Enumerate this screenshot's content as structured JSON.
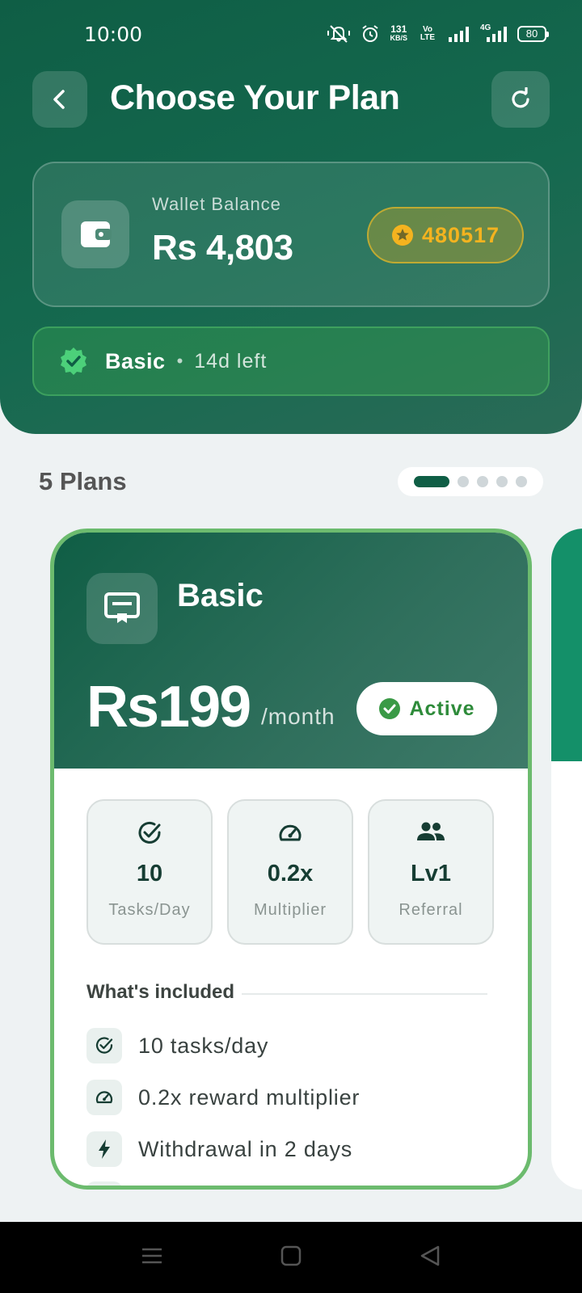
{
  "status_bar": {
    "time": "10:00",
    "net_speed_value": "131",
    "net_speed_unit": "KB/S",
    "volte": "Vo LTE",
    "network": "4G",
    "battery": "80"
  },
  "header": {
    "title": "Choose Your Plan"
  },
  "wallet": {
    "label": "Wallet Balance",
    "amount": "Rs 4,803",
    "coins": "480517"
  },
  "current_plan": {
    "name": "Basic",
    "separator": "•",
    "remaining": "14d left"
  },
  "plans_section": {
    "count_label": "5 Plans",
    "pages": 5,
    "active_page": 1
  },
  "plan_card": {
    "name": "Basic",
    "price": "Rs199",
    "period": "/month",
    "status": "Active",
    "stats": [
      {
        "icon": "check-circle-icon",
        "value": "10",
        "label": "Tasks/Day"
      },
      {
        "icon": "speedometer-icon",
        "value": "0.2x",
        "label": "Multiplier"
      },
      {
        "icon": "people-icon",
        "value": "Lv1",
        "label": "Referral"
      }
    ],
    "included_title": "What's included",
    "features": [
      {
        "icon": "check-circle-icon",
        "text": "10 tasks/day"
      },
      {
        "icon": "speedometer-icon",
        "text": "0.2x reward multiplier"
      },
      {
        "icon": "lightning-icon",
        "text": "Withdrawal in 2 days"
      }
    ]
  },
  "colors": {
    "primary": "#0f5e45",
    "accent_green": "#6cbb6e",
    "coin_gold": "#f4b31f",
    "active_green": "#2e8b3a",
    "next_card": "#149069"
  }
}
